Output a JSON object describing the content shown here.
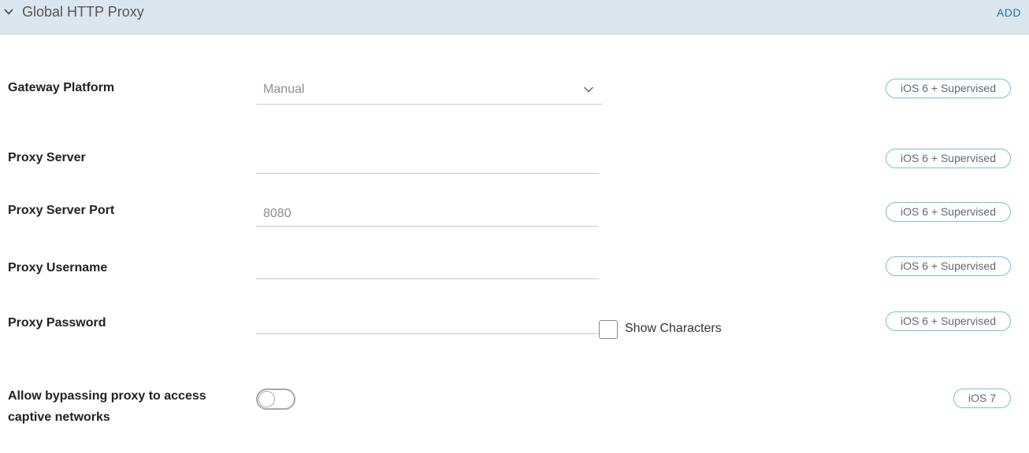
{
  "section": {
    "title": "Global HTTP Proxy",
    "add_label": "ADD"
  },
  "fields": {
    "gateway_platform": {
      "label": "Gateway Platform",
      "selected": "Manual",
      "badge": "iOS 6 + Supervised"
    },
    "proxy_server": {
      "label": "Proxy Server",
      "value": "",
      "placeholder": "",
      "badge": "iOS 6 + Supervised"
    },
    "proxy_server_port": {
      "label": "Proxy Server Port",
      "value": "",
      "placeholder": "8080",
      "badge": "iOS 6 + Supervised"
    },
    "proxy_username": {
      "label": "Proxy Username",
      "value": "",
      "placeholder": "",
      "badge": "iOS 6 + Supervised"
    },
    "proxy_password": {
      "label": "Proxy Password",
      "value": "",
      "placeholder": "",
      "show_characters_label": "Show Characters",
      "show_characters_checked": false,
      "badge": "iOS 6 + Supervised"
    },
    "allow_bypass": {
      "label_line1": "Allow bypassing proxy to access",
      "label_line2": "captive networks",
      "enabled": false,
      "badge": "iOS 7"
    }
  },
  "icons": {
    "collapse": "chevron-down-icon",
    "select_caret": "chevron-down-icon"
  },
  "colors": {
    "header_bg": "#dce6ee",
    "accent": "#1a74a9",
    "badge_border": "#76c2cf"
  }
}
